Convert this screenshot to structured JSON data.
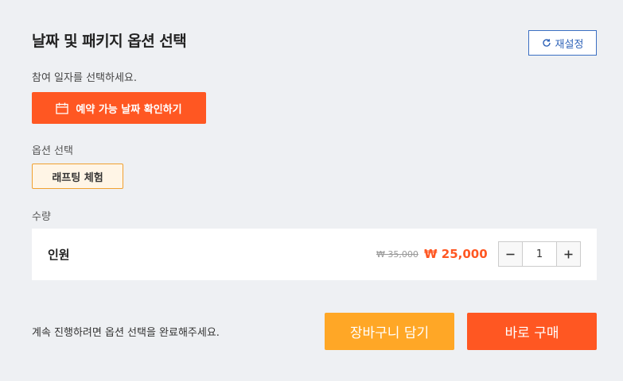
{
  "header": {
    "title": "날짜 및 패키지 옵션 선택",
    "reset_label": "재설정",
    "reset_icon": "refresh-icon"
  },
  "date": {
    "instruction": "참여 일자를 선택하세요.",
    "button_label": "예약 가능 날짜 확인하기",
    "button_icon": "calendar-icon"
  },
  "options": {
    "label": "옵션 선택",
    "selected": "래프팅 체험"
  },
  "quantity": {
    "label": "수량",
    "item_name": "인원",
    "original_price": "₩ 35,000",
    "sale_price": "₩ 25,000",
    "count": "1"
  },
  "footer": {
    "note": "계속 진행하려면 옵션 선택을 완료해주세요.",
    "cart_label": "장바구니 담기",
    "buy_label": "바로 구매"
  },
  "colors": {
    "accent": "#ff5722",
    "secondary": "#ffa726",
    "link": "#2f63b8",
    "background": "#eef0f3"
  }
}
